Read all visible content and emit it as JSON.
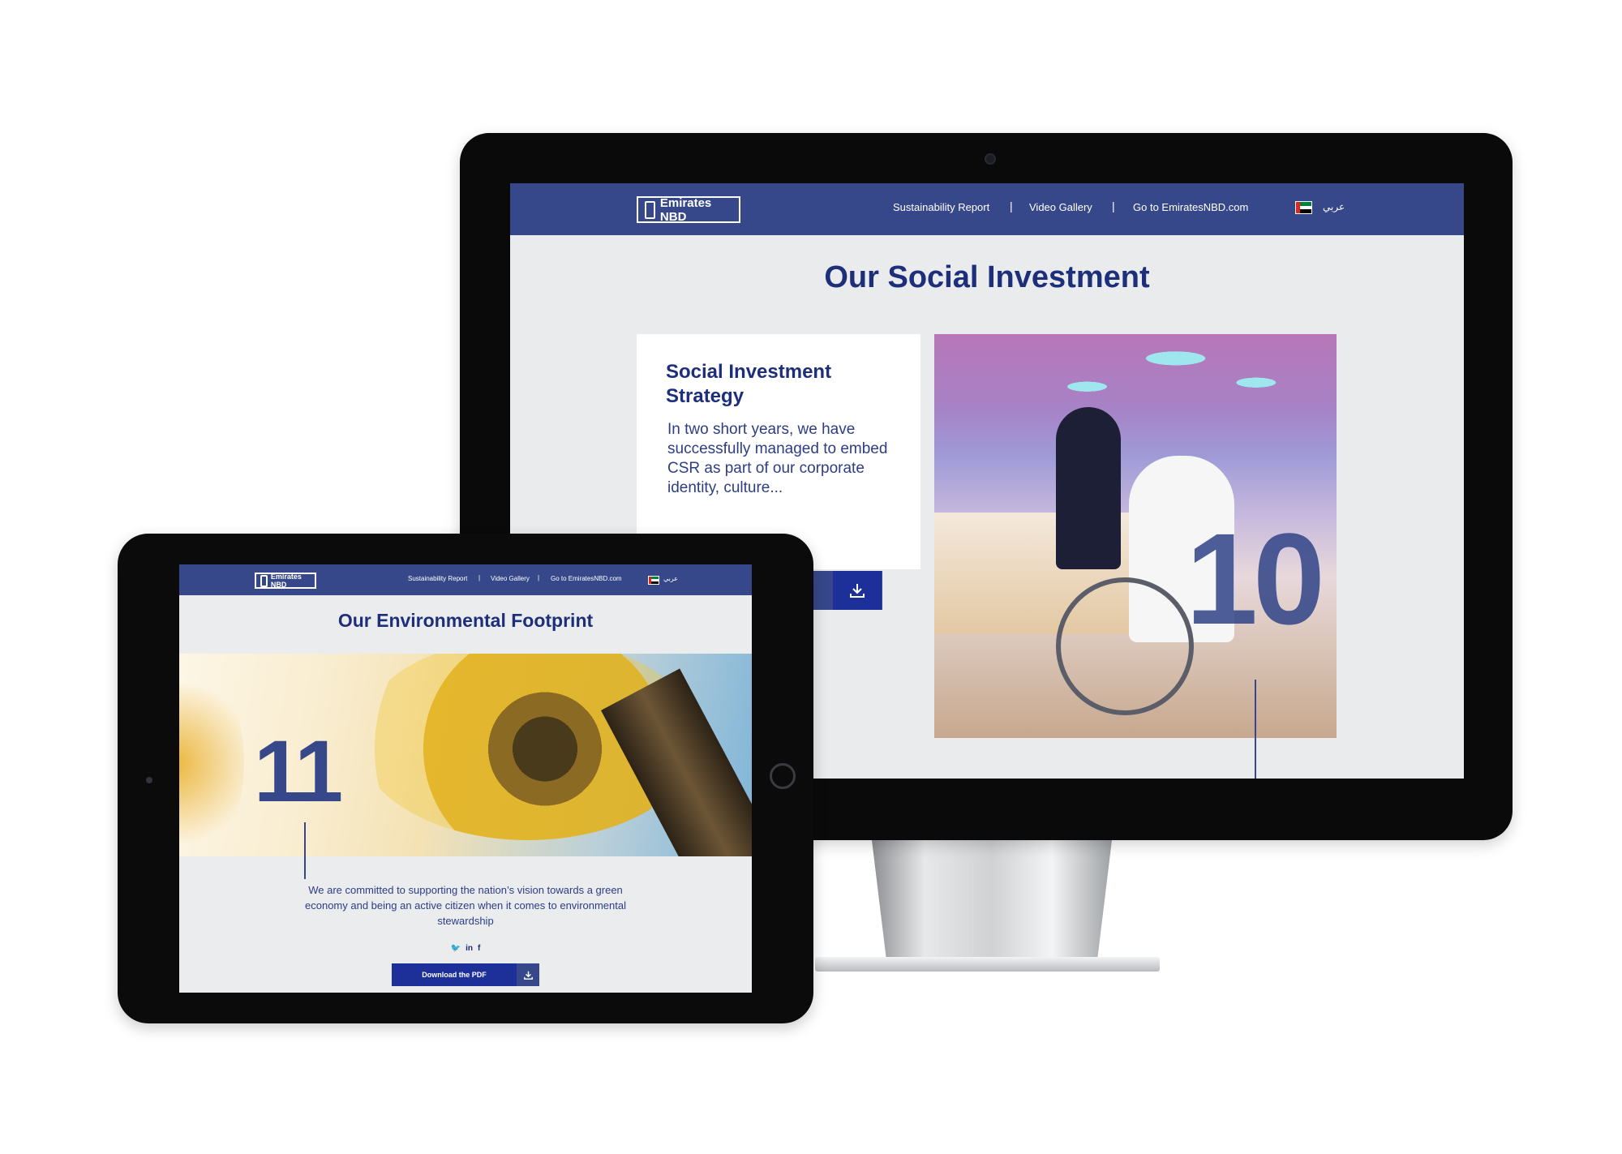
{
  "monitor": {
    "nav": {
      "logo_text": "Emirates NBD",
      "links": [
        "Sustainability Report",
        "Video Gallery",
        "Go to EmiratesNBD.com"
      ],
      "separator": "|",
      "language": "عربي"
    },
    "title": "Our Social Investment",
    "card": {
      "title": "Social Investment Strategy",
      "text": "In two short years, we have successfully managed to embed CSR as part of our corporate identity, culture..."
    },
    "chapter_number": "10",
    "download_icon": "download-icon"
  },
  "tablet": {
    "nav": {
      "logo_text": "Emirates NBD",
      "links": [
        "Sustainability Report",
        "Video Gallery",
        "Go to EmiratesNBD.com"
      ],
      "separator": "|",
      "language": "عربي"
    },
    "title": "Our Environmental Footprint",
    "chapter_number": "11",
    "body_text": "We are committed to supporting the nation’s vision towards a green economy and being an active citizen when it comes to environmental stewardship",
    "social": {
      "twitter": "🐦",
      "linkedin": "in",
      "facebook": "f"
    },
    "download_label": "Download the PDF",
    "download_icon": "download-icon"
  },
  "colors": {
    "brand_blue": "#36488a",
    "title_navy": "#1d2f7a",
    "button_blue": "#1d2f99",
    "page_bg": "#eaebec"
  }
}
